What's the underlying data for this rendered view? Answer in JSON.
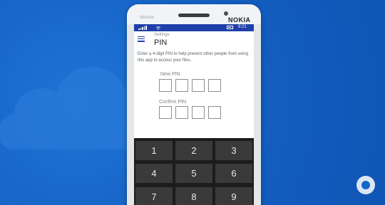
{
  "device": {
    "brand": "NOKIA",
    "carrier": "Verizon"
  },
  "statusbar": {
    "time": "9:21"
  },
  "header": {
    "breadcrumb": "Settings",
    "title": "PIN"
  },
  "description": "Enter a 4-digit PIN to help prevent other people from using this app to access your files.",
  "new_pin": {
    "label": "New PIN",
    "boxes": [
      "",
      "",
      "",
      ""
    ]
  },
  "confirm_pin": {
    "label": "Confirm PIN",
    "boxes": [
      "",
      "",
      "",
      ""
    ]
  },
  "keypad": {
    "keys": [
      "1",
      "2",
      "3",
      "4",
      "5",
      "6",
      "7",
      "8",
      "9"
    ]
  },
  "colors": {
    "background": "#1565c8",
    "accent": "#1f3fa8",
    "keypad": "#1c1c1c",
    "key": "#3a3a3a"
  },
  "icons": {
    "background_art": "cloud-icon",
    "watermark": "neowin-logo-icon"
  }
}
